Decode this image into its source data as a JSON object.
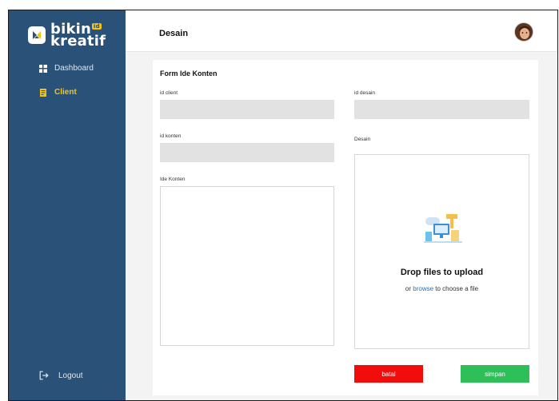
{
  "sidebar": {
    "logo": {
      "line1": "bikin",
      "line2": "kreatif",
      "tag": "id"
    },
    "items": [
      {
        "label": "Dashboard",
        "icon": "grid-icon",
        "active": false
      },
      {
        "label": "Client",
        "icon": "document-icon",
        "active": true
      }
    ],
    "logout": {
      "label": "Logout",
      "icon": "logout-icon"
    }
  },
  "header": {
    "title": "Desain",
    "avatar_icon": "user-avatar"
  },
  "form": {
    "title": "Form Ide Konten",
    "fields": {
      "id_client": {
        "label": "id client",
        "value": ""
      },
      "id_konten": {
        "label": "id konten",
        "value": ""
      },
      "ide_konten": {
        "label": "Ide Konten",
        "value": ""
      },
      "id_desain": {
        "label": "id desain",
        "value": ""
      },
      "desain": {
        "label": "Desain"
      }
    },
    "dropzone": {
      "title": "Drop files to upload",
      "sub_prefix": "or",
      "browse": "browse",
      "sub_suffix": "to choose a file",
      "icon": "upload-illustration-icon"
    },
    "buttons": {
      "cancel": "batal",
      "save": "simpan"
    }
  },
  "colors": {
    "sidebar": "#2a5278",
    "accent": "#f2c417",
    "cancel": "#f20d0d",
    "save": "#2fbf58",
    "link": "#2f6fa8"
  }
}
